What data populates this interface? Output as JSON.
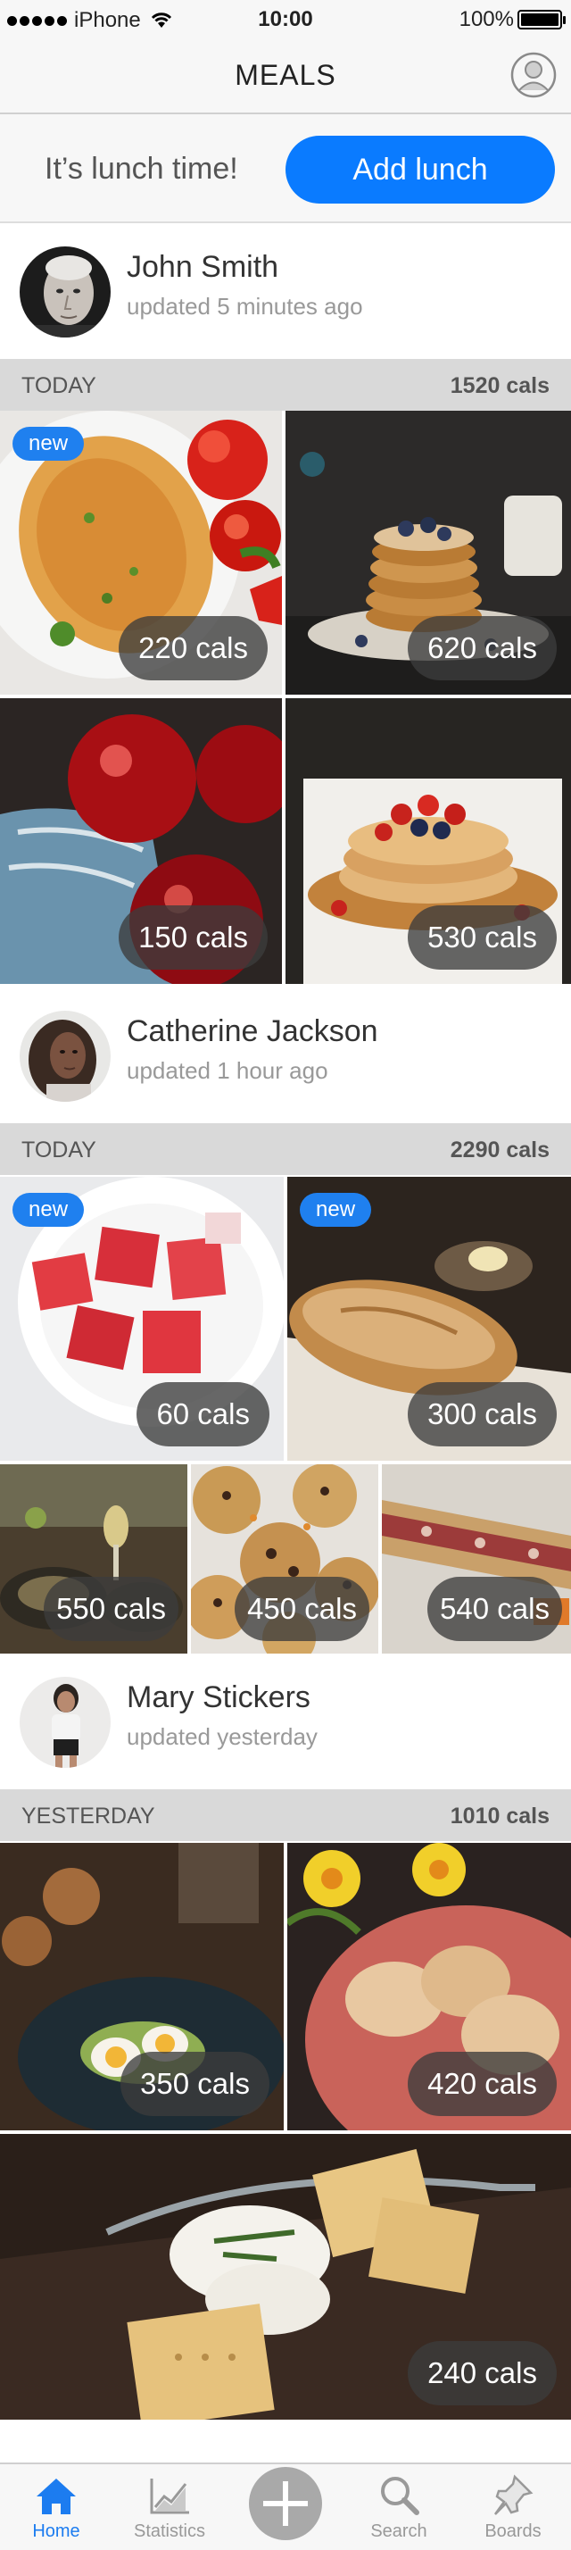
{
  "status_bar": {
    "carrier": "iPhone",
    "time": "10:00",
    "battery": "100%",
    "battery_level": 1.0
  },
  "nav": {
    "title": "MEALS"
  },
  "lunch_prompt": {
    "text": "It’s lunch time!",
    "button": "Add lunch"
  },
  "feed": [
    {
      "user": "John Smith",
      "updated": "updated 5 minutes ago",
      "day": "TODAY",
      "total": "1520 cals",
      "meals": [
        {
          "cals": "220 cals",
          "badge": "new",
          "picture": "omelette-tomatoes"
        },
        {
          "cals": "620 cals",
          "badge": "",
          "picture": "pancake-stack-blueberries"
        },
        {
          "cals": "150 cals",
          "badge": "",
          "picture": "red-apples-napkin"
        },
        {
          "cals": "530 cals",
          "badge": "",
          "picture": "pancakes-berries"
        }
      ]
    },
    {
      "user": "Catherine Jackson",
      "updated": "updated 1 hour ago",
      "day": "TODAY",
      "total": "2290 cals",
      "meals": [
        {
          "cals": "60 cals",
          "badge": "new",
          "picture": "watermelon-bowl"
        },
        {
          "cals": "300 cals",
          "badge": "new",
          "picture": "bread-loaf"
        },
        {
          "cals": "550 cals",
          "badge": "",
          "picture": "dinner-table-wine"
        },
        {
          "cals": "450 cals",
          "badge": "",
          "picture": "chocolate-chip-cookies"
        },
        {
          "cals": "540 cals",
          "badge": "",
          "picture": "salami-sandwich"
        }
      ]
    },
    {
      "user": "Mary Stickers",
      "updated": "updated yesterday",
      "day": "YESTERDAY",
      "total": "1010 cals",
      "meals": [
        {
          "cals": "350 cals",
          "badge": "",
          "picture": "egg-avocado-plate"
        },
        {
          "cals": "420 cals",
          "badge": "",
          "picture": "pastries-daffodils"
        },
        {
          "cals": "240 cals",
          "badge": "",
          "picture": "crackers-cheese-board"
        }
      ]
    }
  ],
  "tabs": [
    {
      "label": "Home",
      "icon": "home-icon",
      "active": true
    },
    {
      "label": "Statistics",
      "icon": "chart-icon",
      "active": false
    },
    {
      "label": "",
      "icon": "add-icon",
      "active": false
    },
    {
      "label": "Search",
      "icon": "search-icon",
      "active": false
    },
    {
      "label": "Boards",
      "icon": "pin-icon",
      "active": false
    }
  ],
  "colors": {
    "accent": "#0a7bff",
    "badge": "#1f80ef",
    "section_bar": "#d9d9d9",
    "tab_active": "#1c7cf0"
  }
}
